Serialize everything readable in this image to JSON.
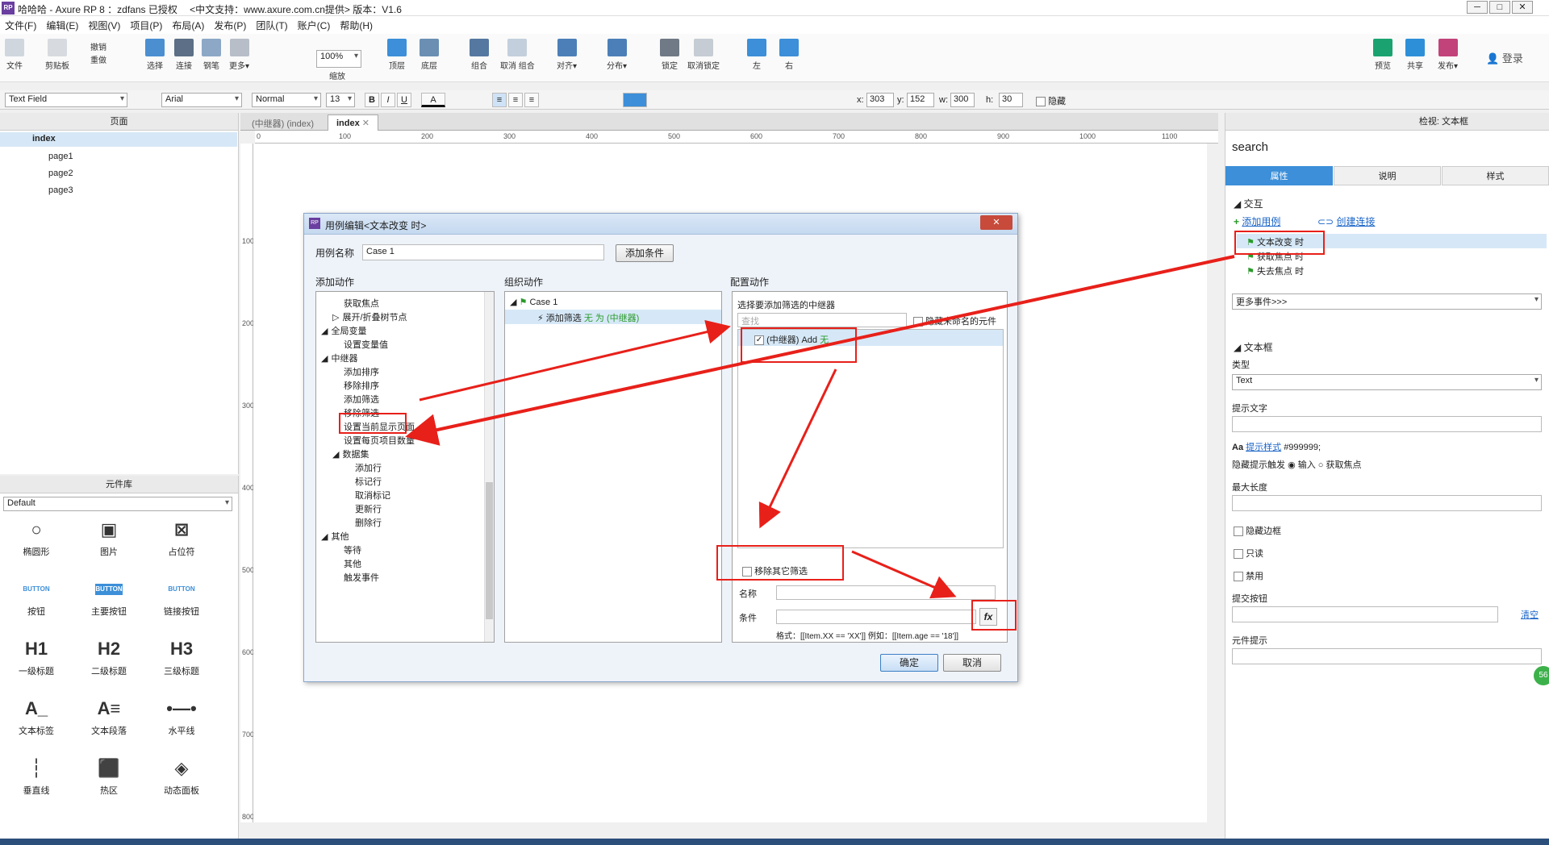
{
  "window": {
    "title": "哈哈哈 - Axure RP 8 ：zdfans 已授权　 <中文支持：www.axure.com.cn提供> 版本：V1.6",
    "logo": "RP",
    "controls": [
      "─",
      "□",
      "✕"
    ]
  },
  "menu": [
    "文件(F)",
    "编辑(E)",
    "视图(V)",
    "项目(P)",
    "布局(A)",
    "发布(P)",
    "团队(T)",
    "账户(C)",
    "帮助(H)"
  ],
  "toolbar": {
    "file": "文件",
    "clipboard": "剪贴板",
    "undo": "撤销",
    "redo": "重做",
    "select": "选择",
    "connect": "连接",
    "pen": "钢笔",
    "more": "更多▾",
    "zoom_value": "100%",
    "zoom_label": "缩放",
    "top": "顶层",
    "bottom": "底层",
    "group": "组合",
    "ungroup": "取消 组合",
    "align": "对齐▾",
    "distribute": "分布▾",
    "lock": "锁定",
    "unlock": "取消锁定",
    "left": "左",
    "right": "右",
    "preview": "预览",
    "share": "共享",
    "publish": "发布▾",
    "login": "登录"
  },
  "format": {
    "widget_type": "Text Field",
    "font": "Arial",
    "style": "Normal",
    "size": "13",
    "bold": "B",
    "italic": "I",
    "underline": "U",
    "font_color": "A",
    "x_label": "x:",
    "x": "303",
    "y_label": "y:",
    "y": "152",
    "w_label": "w:",
    "w": "300",
    "h_label": "h:",
    "h": "30",
    "hidden": "隐藏"
  },
  "pages": {
    "header": "页面",
    "items": [
      "index",
      "page1",
      "page2",
      "page3"
    ]
  },
  "library": {
    "header": "元件库",
    "selected": "Default",
    "items": [
      {
        "icon": "○",
        "label": "椭圆形"
      },
      {
        "icon": "▣",
        "label": "图片"
      },
      {
        "icon": "⊠",
        "label": "占位符"
      },
      {
        "icon": "BUTTON",
        "label": "按钮"
      },
      {
        "icon": "BUTTON",
        "label": "主要按钮"
      },
      {
        "icon": "BUTTON",
        "label": "链接按钮"
      },
      {
        "icon": "H1",
        "label": "一级标题"
      },
      {
        "icon": "H2",
        "label": "二级标题"
      },
      {
        "icon": "H3",
        "label": "三级标题"
      },
      {
        "icon": "A_",
        "label": "文本标签"
      },
      {
        "icon": "A≡",
        "label": "文本段落"
      },
      {
        "icon": "•—•",
        "label": "水平线"
      },
      {
        "icon": "┆",
        "label": "垂直线"
      },
      {
        "icon": "⬛",
        "label": "热区"
      },
      {
        "icon": "◈",
        "label": "动态面板"
      }
    ]
  },
  "tabs": [
    {
      "label": "(中继器) (index)"
    },
    {
      "label": "index"
    }
  ],
  "ruler_h": [
    "0",
    "100",
    "200",
    "300",
    "400",
    "500",
    "600",
    "700",
    "800",
    "900",
    "1000",
    "1100"
  ],
  "ruler_v": [
    "100",
    "200",
    "300",
    "400",
    "500",
    "600",
    "700",
    "800"
  ],
  "inspector": {
    "header": "检视: 文本框",
    "name": "search",
    "tabs": [
      "属性",
      "说明",
      "样式"
    ],
    "interaction_header": "交互",
    "add_case": "添加用例",
    "create_link": "创建连接",
    "events": [
      "文本改变 时",
      "获取焦点 时",
      "失去焦点 时"
    ],
    "more_events": "更多事件>>>",
    "textbox_header": "文本框",
    "type_label": "类型",
    "type_value": "Text",
    "hint_label": "提示文字",
    "hint_style": "提示样式",
    "hint_color": "#999999;",
    "hide_hint": "隐藏提示触发",
    "hide_opt1": "输入",
    "hide_opt2": "获取焦点",
    "maxlen": "最大长度",
    "hide_border": "隐藏边框",
    "readonly": "只读",
    "disabled": "禁用",
    "submit": "提交按钮",
    "clear": "清空",
    "tooltip": "元件提示",
    "badge": "56"
  },
  "dialog": {
    "title": "用例编辑<文本改变 时>",
    "case_name_label": "用例名称",
    "case_name": "Case 1",
    "add_condition": "添加条件",
    "col1": "添加动作",
    "col2": "组织动作",
    "col3": "配置动作",
    "actions": [
      {
        "label": "获取焦点",
        "indent": 2
      },
      {
        "label": "展开/折叠树节点",
        "indent": 2,
        "arrow": "▷"
      },
      {
        "label": "全局变量",
        "indent": 1,
        "arrow": "◢"
      },
      {
        "label": "设置变量值",
        "indent": 2
      },
      {
        "label": "中继器",
        "indent": 1,
        "arrow": "◢"
      },
      {
        "label": "添加排序",
        "indent": 2
      },
      {
        "label": "移除排序",
        "indent": 2
      },
      {
        "label": "添加筛选",
        "indent": 2
      },
      {
        "label": "移除筛选",
        "indent": 2
      },
      {
        "label": "设置当前显示页面",
        "indent": 2
      },
      {
        "label": "设置每页项目数量",
        "indent": 2
      },
      {
        "label": "数据集",
        "indent": 2,
        "arrow": "◢"
      },
      {
        "label": "添加行",
        "indent": 3
      },
      {
        "label": "标记行",
        "indent": 3
      },
      {
        "label": "取消标记",
        "indent": 3
      },
      {
        "label": "更新行",
        "indent": 3
      },
      {
        "label": "删除行",
        "indent": 3
      },
      {
        "label": "其他",
        "indent": 1,
        "arrow": "◢"
      },
      {
        "label": "等待",
        "indent": 2
      },
      {
        "label": "其他",
        "indent": 2
      },
      {
        "label": "触发事件",
        "indent": 2
      }
    ],
    "org_case": "Case 1",
    "org_action": "添加筛选 ",
    "org_action_detail": "无 为 (中继器)",
    "config_prompt": "选择要添加筛选的中继器",
    "search_placeholder": "查找",
    "hide_unnamed": "隐藏未命名的元件",
    "repeater_item": "(中继器) Add ",
    "repeater_item_detail": "无",
    "remove_other": "移除其它筛选",
    "name_label": "名称",
    "condition_label": "条件",
    "fx": "fx",
    "format_hint": "格式：[[Item.XX == 'XX']] 例如：[[Item.age == '18']]",
    "ok": "确定",
    "cancel": "取消"
  },
  "colors": {
    "annotation": "#e8201a",
    "accent": "#3c8fd8",
    "selection": "#d6e8f7"
  }
}
